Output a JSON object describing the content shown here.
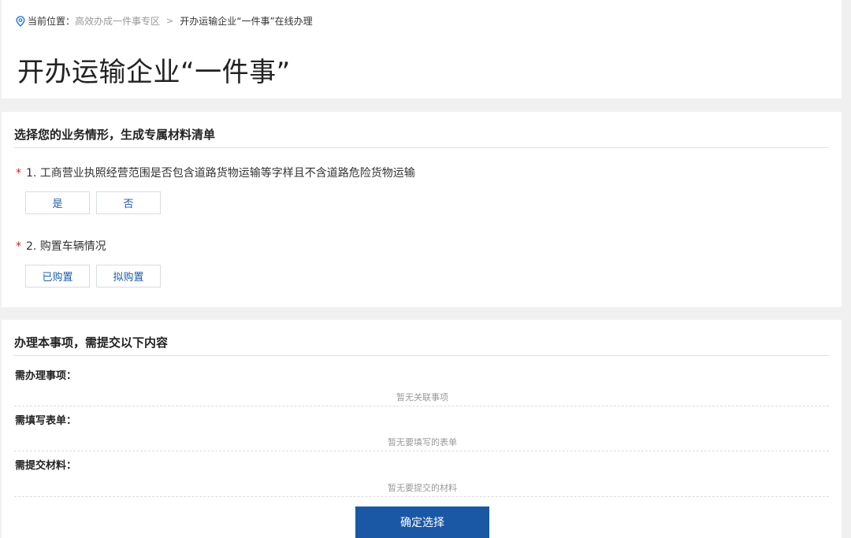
{
  "breadcrumb": {
    "prefix": "当前位置：",
    "parent": "高效办成一件事专区",
    "separator": ">",
    "current": "开办运输企业“一件事”在线办理"
  },
  "page_title": "开办运输企业“一件事”",
  "questions_section": {
    "title": "选择您的业务情形，生成专属材料清单",
    "required_mark": "*",
    "questions": [
      {
        "label": "1. 工商营业执照经营范围是否包含道路货物运输等字样且不含道路危险货物运输",
        "options": [
          "是",
          "否"
        ]
      },
      {
        "label": "2. 购置车辆情况",
        "options": [
          "已购置",
          "拟购置"
        ]
      }
    ]
  },
  "result_section": {
    "title": "办理本事项，需提交以下内容",
    "items": [
      {
        "label": "需办理事项：",
        "empty": "暂无关联事项"
      },
      {
        "label": "需填写表单：",
        "empty": "暂无要填写的表单"
      },
      {
        "label": "需提交材料：",
        "empty": "暂无要提交的材料"
      }
    ],
    "confirm": "确定选择"
  },
  "colors": {
    "accent": "#1a58a6",
    "link": "#1e5fa8",
    "required": "#e02020",
    "background": "#f0f0f0"
  },
  "icons": {
    "breadcrumb": "location-pin-icon"
  }
}
